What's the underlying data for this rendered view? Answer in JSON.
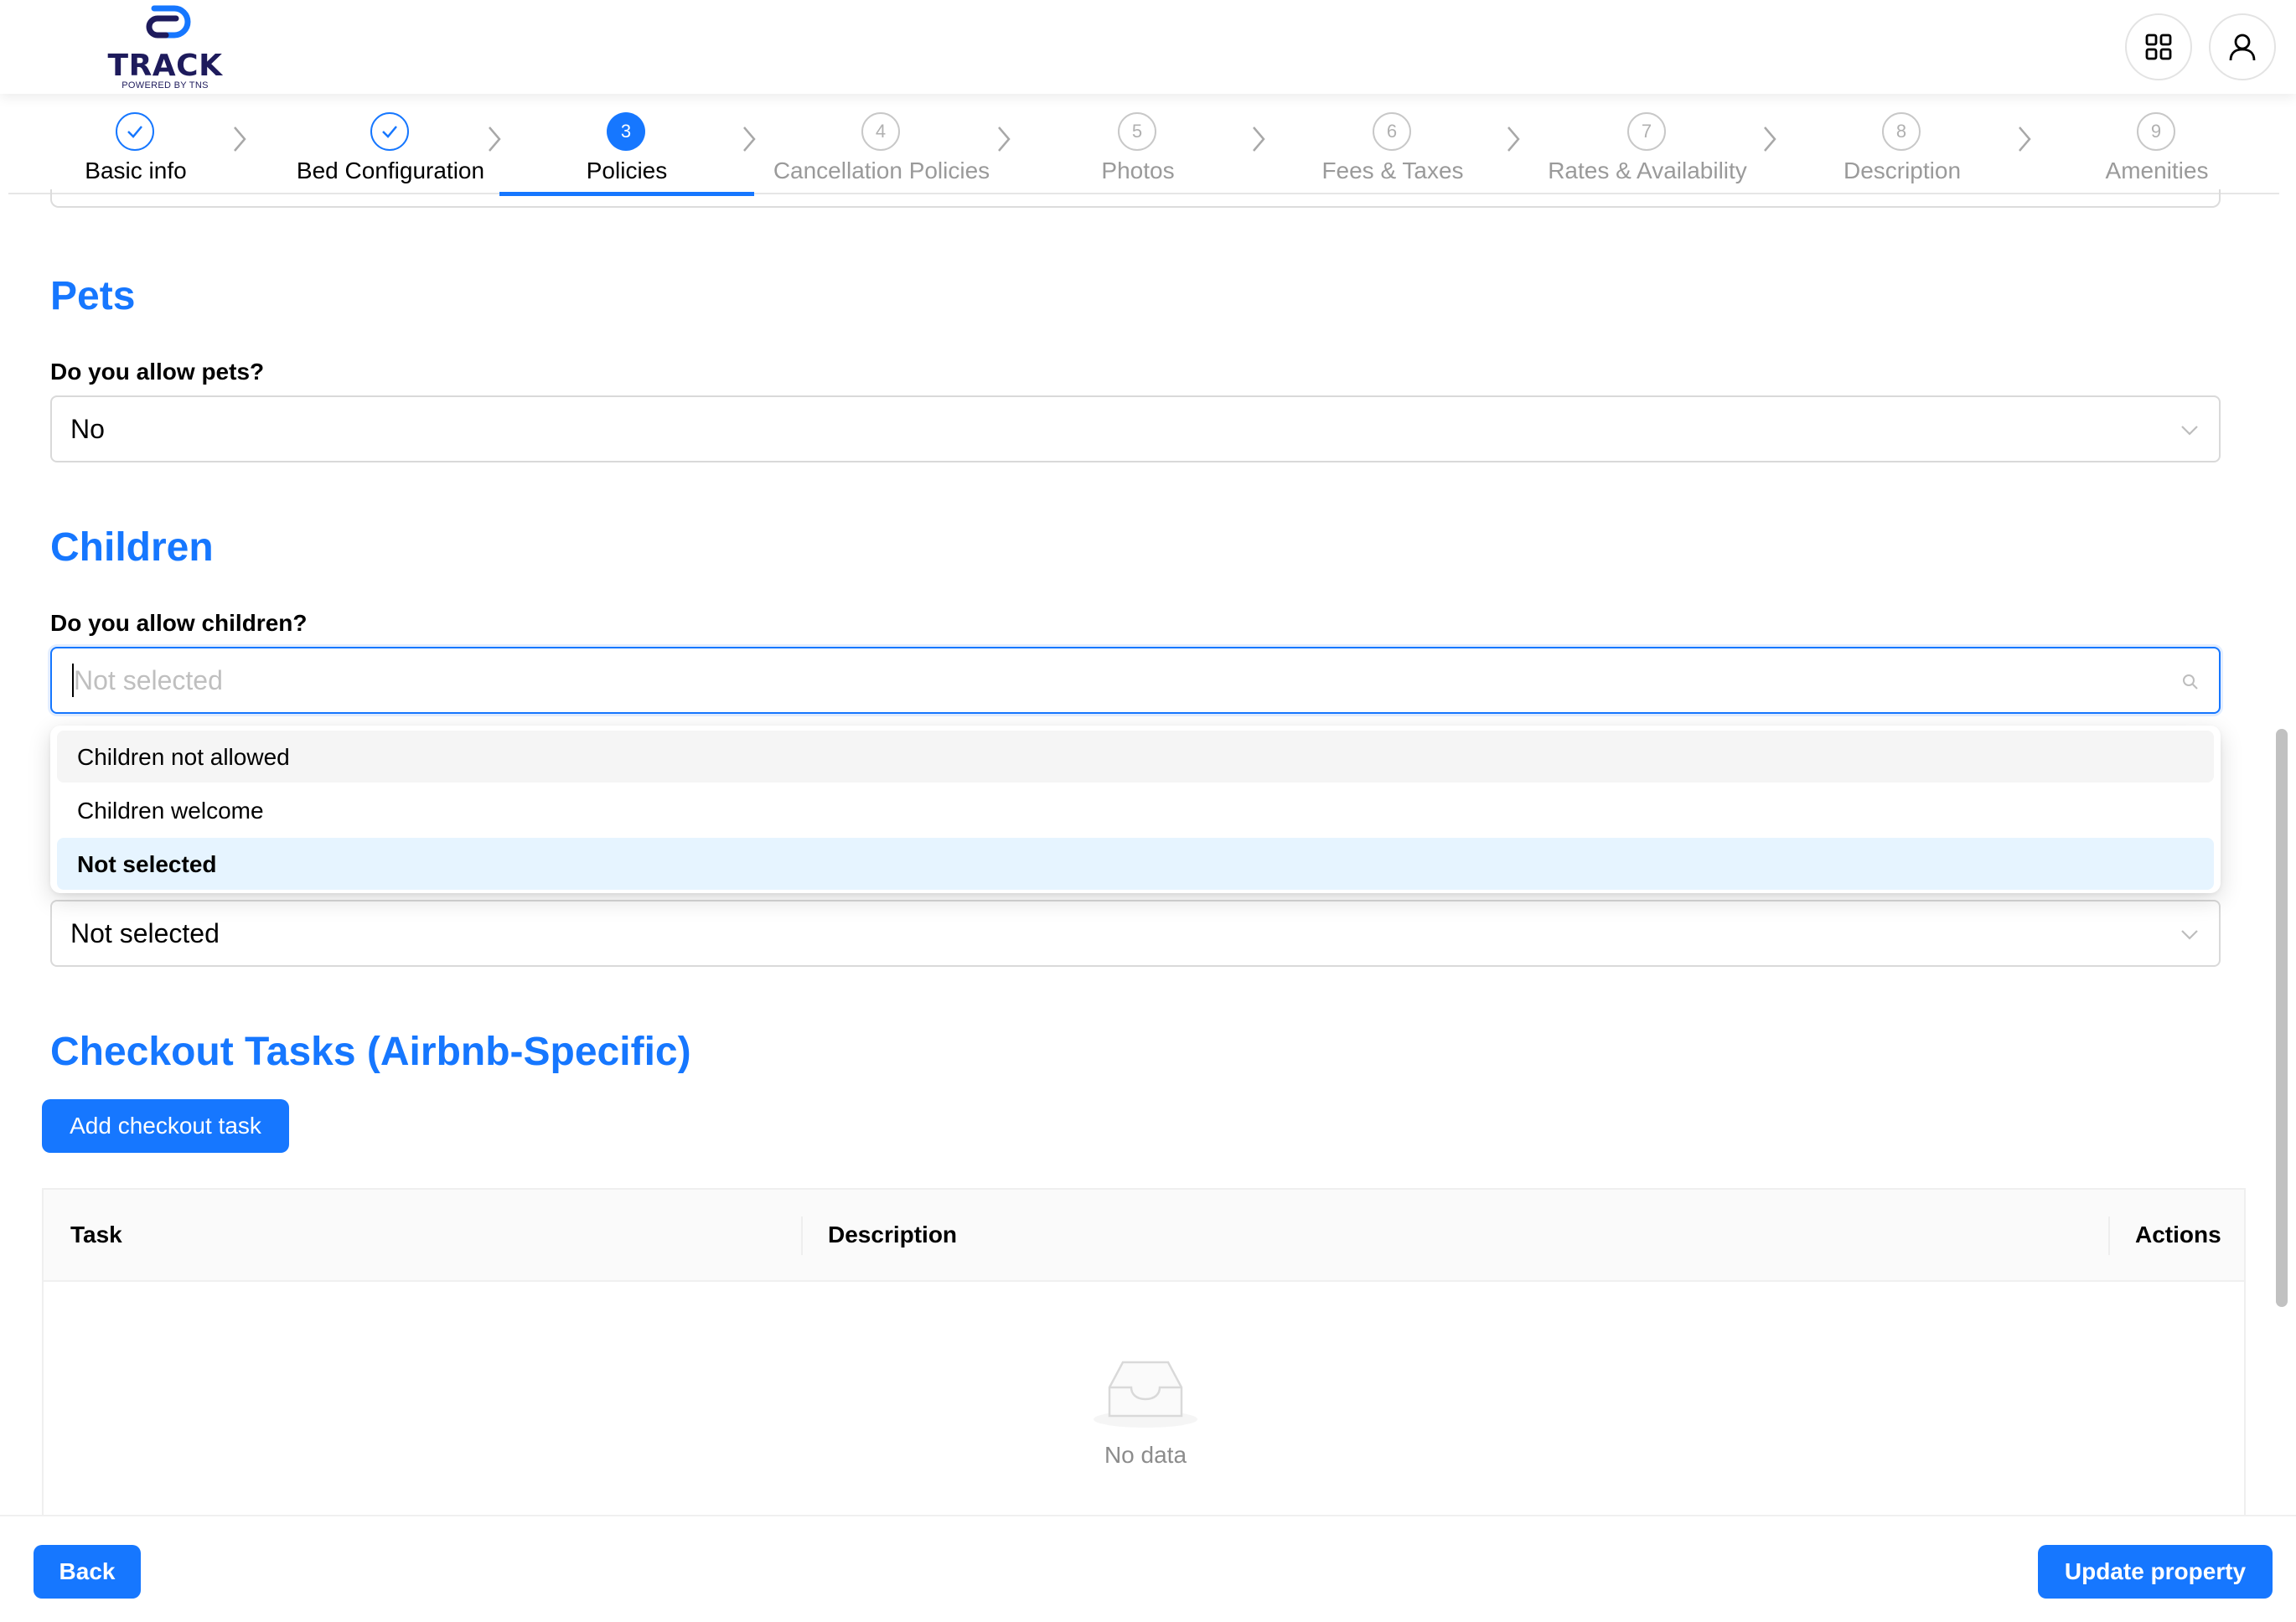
{
  "brand": {
    "name": "TRACK",
    "tagline": "POWERED BY TNS",
    "color": "#1e1b5c",
    "accent": "#1677ff"
  },
  "header": {
    "apps_icon": "grid-icon",
    "user_icon": "user-icon"
  },
  "stepper": {
    "steps": [
      {
        "label": "Basic info",
        "number": "1",
        "status": "done"
      },
      {
        "label": "Bed Configuration",
        "number": "2",
        "status": "done"
      },
      {
        "label": "Policies",
        "number": "3",
        "status": "active"
      },
      {
        "label": "Cancellation Policies",
        "number": "4",
        "status": "todo"
      },
      {
        "label": "Photos",
        "number": "5",
        "status": "todo"
      },
      {
        "label": "Fees & Taxes",
        "number": "6",
        "status": "todo"
      },
      {
        "label": "Rates & Availability",
        "number": "7",
        "status": "todo"
      },
      {
        "label": "Description",
        "number": "8",
        "status": "todo"
      },
      {
        "label": "Amenities",
        "number": "9",
        "status": "todo"
      }
    ]
  },
  "pets": {
    "title": "Pets",
    "question": "Do you allow pets?",
    "value": "No"
  },
  "children": {
    "title": "Children",
    "question": "Do you allow children?",
    "placeholder": "Not selected",
    "options": [
      "Children not allowed",
      "Children welcome",
      "Not selected"
    ],
    "selected_option": "Not selected",
    "hovered_option": "Children not allowed"
  },
  "hidden_select": {
    "value": "Not selected"
  },
  "checkout": {
    "title": "Checkout Tasks (Airbnb-Specific)",
    "add_button": "Add checkout task",
    "columns": [
      "Task",
      "Description",
      "Actions"
    ],
    "empty_text": "No data"
  },
  "footer": {
    "back_button": "Back",
    "update_button": "Update property"
  }
}
